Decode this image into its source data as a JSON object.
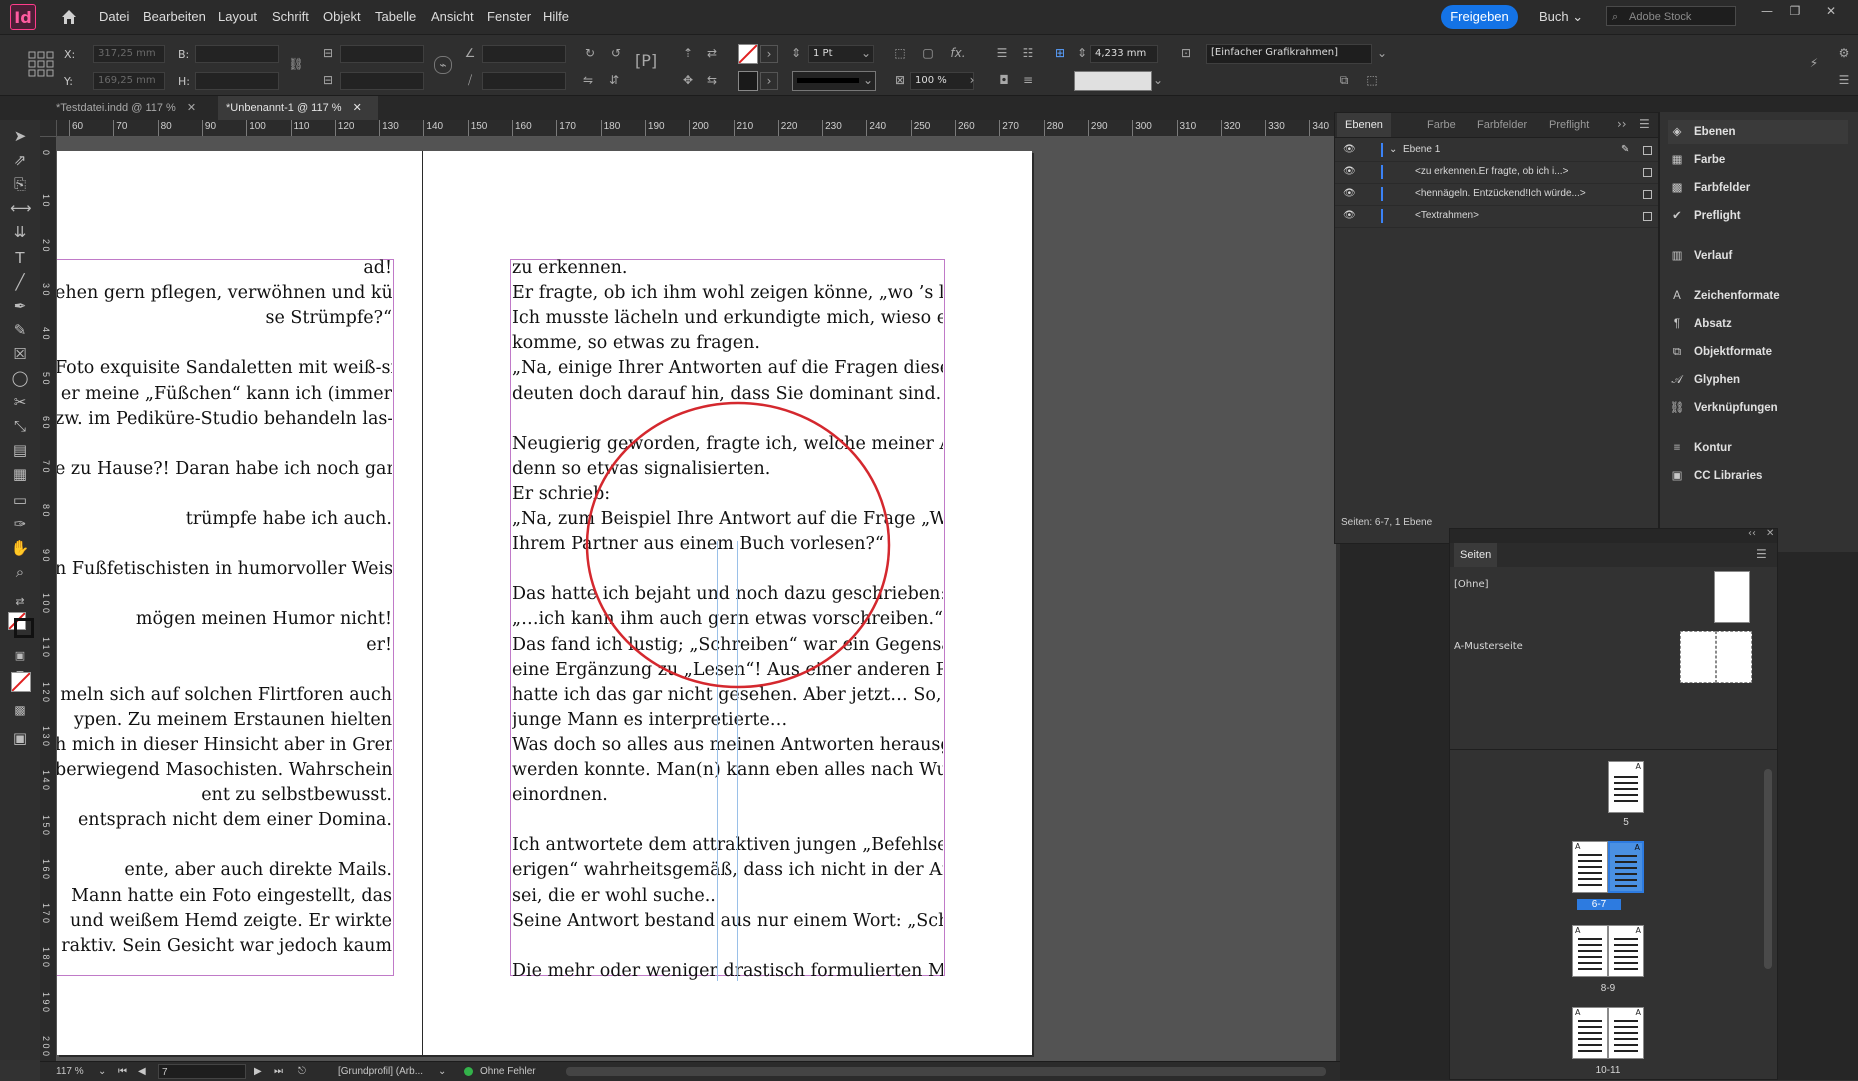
{
  "app": {
    "logo_text": "Id"
  },
  "menu": [
    "Datei",
    "Bearbeiten",
    "Layout",
    "Schrift",
    "Objekt",
    "Tabelle",
    "Ansicht",
    "Fenster",
    "Hilfe"
  ],
  "header": {
    "share_label": "Freigeben",
    "workspace_label": "Buch",
    "stock_placeholder": "Adobe Stock"
  },
  "control": {
    "x_label": "X:",
    "y_label": "Y:",
    "b_label": "B:",
    "h_label": "H:",
    "x_value": "317,25 mm",
    "y_value": "169,25 mm",
    "stroke_weight": "1 Pt",
    "scale": "100 %",
    "offset": "4,233 mm",
    "frame_style": "[Einfacher Grafikrahmen]"
  },
  "tabs": [
    {
      "label": "*Testdatei.indd @ 117 %",
      "active": false
    },
    {
      "label": "*Unbenannt-1 @ 117 %",
      "active": true
    }
  ],
  "ruler": {
    "labels": [
      "60",
      "70",
      "80",
      "90",
      "100",
      "110",
      "120",
      "130",
      "140",
      "150",
      "160",
      "170",
      "180",
      "190",
      "200",
      "210",
      "220",
      "230",
      "240",
      "250",
      "260",
      "270",
      "280",
      "290",
      "300",
      "310",
      "320",
      "330",
      "340"
    ]
  },
  "vruler": {
    "labels": [
      "0",
      "1 0",
      "2 0",
      "3 0",
      "4 0",
      "5 0",
      "6 0",
      "7 0",
      "8 0",
      "9 0",
      "1 0 0",
      "1 1 0",
      "1 2 0",
      "1 3 0",
      "1 4 0",
      "1 5 0",
      "1 6 0",
      "1 7 0",
      "1 8 0",
      "1 9 0",
      "2 0 0"
    ]
  },
  "left_page": {
    "lines": [
      "ad!",
      "ehen gern pflegen, verwöhnen und küs-",
      "se Strümpfe?“",
      "",
      "Foto exquisite Sandaletten mit weiß-sil-",
      "er meine „Füßchen“ kann ich (immer",
      "zw. im Pediküre-Studio behandeln las-",
      "",
      "e zu Hause?! Daran habe ich noch gar",
      "",
      "trümpfe habe ich auch.",
      "",
      "n Fußfetischisten in humorvoller Weise",
      "",
      "mögen meinen Humor nicht!",
      "er!",
      "",
      "meln sich auf solchen Flirtforen auch",
      "ypen. Zu meinem Erstaunen hielten",
      "h mich in dieser Hinsicht aber in Gren-",
      "berwiegend Masochisten. Wahrschein-",
      "ent zu selbstbewusst.",
      "entsprach nicht dem einer Domina.",
      "",
      "ente, aber auch direkte Mails.",
      "Mann hatte ein Foto eingestellt, das",
      "und weißem Hemd zeigte. Er wirkte",
      "raktiv. Sein Gesicht war jedoch kaum"
    ]
  },
  "right_page": {
    "lines": [
      "zu erkennen.",
      "Er fragte, ob ich ihm wohl zeigen könne, „wo ’s langgehe…“",
      "Ich musste lächeln und erkundigte mich, wieso er darauf",
      "komme, so etwas zu fragen.",
      "„Na, einige Ihrer Antworten auf die Fragen dieser Plattform",
      "deuten doch darauf hin, dass Sie dominant sind.“",
      "",
      "Neugierig geworden, fragte ich, welche meiner Antworten",
      "denn so etwas signalisierten.",
      "Er schrieb:",
      "„Na, zum Beispiel Ihre Antwort auf die Frage „Würden Sie",
      "Ihrem Partner aus einem Buch vorlesen?“",
      "",
      "Das hatte ich bejaht und noch dazu geschrieben:",
      "„…ich kann ihm auch gern etwas vorschreiben.“",
      "Das fand ich lustig; „Schreiben“ war ein Gegensatz, nein,",
      "eine Ergänzung zu „Lesen“! Aus einer anderen Perspektive",
      "hatte ich das gar nicht gesehen. Aber jetzt… So, wie der",
      "junge Mann es interpretierte…",
      "Was doch so alles aus meinen Antworten herausgelesen",
      "werden konnte. Man(n) kann eben alles nach Wunsch",
      "einordnen.",
      "",
      "Ich antwortete dem attraktiven jungen „Befehlsempfangsgi-",
      "erigen“ wahrheitsgemäß, dass ich nicht in der Art dominant",
      "sei, die er wohl suche..",
      "Seine Antwort bestand aus nur einem Wort: „Schade!“",
      "",
      "Die mehr oder weniger drastisch formulierten Mails möchte"
    ]
  },
  "status": {
    "zoom": "117 %",
    "page": "7",
    "profile": "[Grundprofil] (Arb...",
    "preflight": "Ohne Fehler"
  },
  "layers_panel": {
    "tabs": [
      "Ebenen",
      "Farbe",
      "Farbfelder",
      "Preflight"
    ],
    "layer_name": "Ebene 1",
    "items": [
      "<zu erkennen.Er fragte, ob ich i...>",
      "<hennägeln. Entzückend!Ich würde...>",
      "<Textrahmen>"
    ],
    "footer": "Seiten: 6-7, 1 Ebene"
  },
  "icon_panels": [
    "Ebenen",
    "Farbe",
    "Farbfelder",
    "Preflight",
    "Verlauf",
    "Zeichenformate",
    "Absatz",
    "Objektformate",
    "Glyphen",
    "Verknüpfungen",
    "Kontur",
    "CC Libraries"
  ],
  "pages_panel": {
    "title": "Seiten",
    "none_label": "[Ohne]",
    "master_label": "A-Musterseite",
    "spreads": [
      "5",
      "6-7",
      "8-9",
      "10-11"
    ]
  },
  "colors": {
    "accent": "#1473e6",
    "frame": "#c07ac8",
    "annotation": "#d4282e",
    "selected_spread": "#2d7be0"
  }
}
